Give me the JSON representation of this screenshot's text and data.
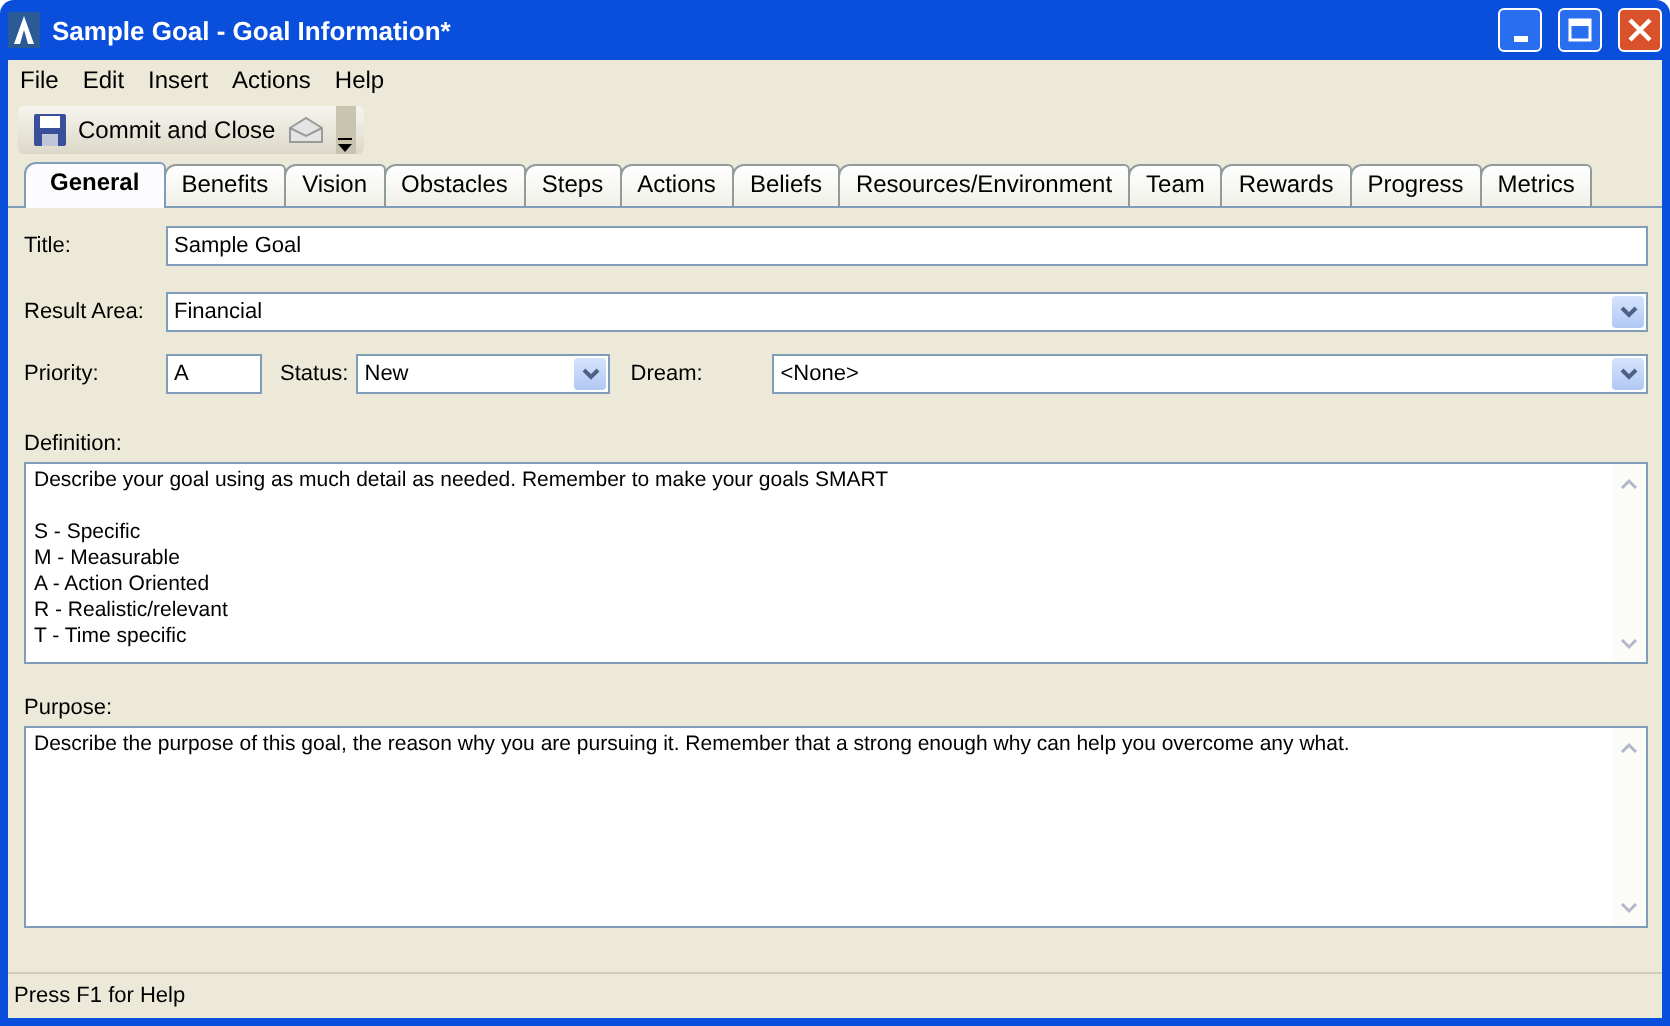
{
  "window": {
    "title": "Sample Goal - Goal Information*"
  },
  "menu": [
    "File",
    "Edit",
    "Insert",
    "Actions",
    "Help"
  ],
  "toolbar": {
    "commit_button": "Commit and Close"
  },
  "tabs": [
    {
      "label": "General",
      "selected": true
    },
    {
      "label": "Benefits",
      "selected": false
    },
    {
      "label": "Vision",
      "selected": false
    },
    {
      "label": "Obstacles",
      "selected": false
    },
    {
      "label": "Steps",
      "selected": false
    },
    {
      "label": "Actions",
      "selected": false
    },
    {
      "label": "Beliefs",
      "selected": false
    },
    {
      "label": "Resources/Environment",
      "selected": false
    },
    {
      "label": "Team",
      "selected": false
    },
    {
      "label": "Rewards",
      "selected": false
    },
    {
      "label": "Progress",
      "selected": false
    },
    {
      "label": "Metrics",
      "selected": false
    }
  ],
  "form": {
    "title": {
      "label": "Title:",
      "value": "Sample Goal"
    },
    "result_area": {
      "label": "Result Area:",
      "value": "Financial"
    },
    "priority": {
      "label": "Priority:",
      "value": "A"
    },
    "status": {
      "label": "Status:",
      "value": "New"
    },
    "dream": {
      "label": "Dream:",
      "value": "<None>"
    },
    "definition": {
      "label": "Definition:",
      "paragraphs": [
        [
          "Describe your goal using as much detail as needed. Remember to make your goals SMART"
        ],
        [
          "S - Specific",
          "M - Measurable",
          "A - Action Oriented",
          "R - Realistic/relevant",
          "T - Time specific"
        ]
      ]
    },
    "purpose": {
      "label": "Purpose:",
      "paragraphs": [
        [
          "Describe the purpose of this goal, the reason why you are pursuing it. Remember that a strong enough why can help you overcome any what."
        ]
      ]
    }
  },
  "status_bar": "Press F1 for Help"
}
